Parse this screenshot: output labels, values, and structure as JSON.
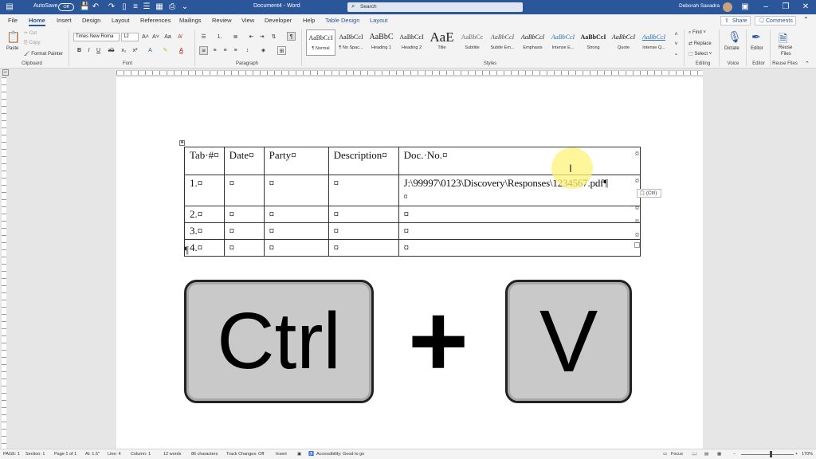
{
  "titlebar": {
    "autosave_label": "AutoSave",
    "autosave_state": "Off",
    "doc_title": "Document4 - Word",
    "search_placeholder": "Search",
    "user_name": "Deborah Savadra"
  },
  "tabs": [
    "File",
    "Home",
    "Insert",
    "Design",
    "Layout",
    "References",
    "Mailings",
    "Review",
    "View",
    "Developer",
    "Help",
    "Table Design",
    "Layout"
  ],
  "share_label": "Share",
  "comments_label": "Comments",
  "clipboard": {
    "paste": "Paste",
    "cut": "Cut",
    "copy": "Copy",
    "format_painter": "Format Painter",
    "group": "Clipboard"
  },
  "font": {
    "name": "Times New Roma",
    "size": "12",
    "group": "Font"
  },
  "paragraph_group": "Paragraph",
  "styles": [
    {
      "preview": "AaBbCcI",
      "name": "¶ Normal"
    },
    {
      "preview": "AaBbCcI",
      "name": "¶ No Spac..."
    },
    {
      "preview": "AaBbC",
      "name": "Heading 1"
    },
    {
      "preview": "AaBbCcI",
      "name": "Heading 2"
    },
    {
      "preview": "AaE",
      "name": "Title"
    },
    {
      "preview": "AaBbCc",
      "name": "Subtitle"
    },
    {
      "preview": "AaBbCcI",
      "name": "Subtle Em..."
    },
    {
      "preview": "AaBbCcI",
      "name": "Emphasis"
    },
    {
      "preview": "AaBbCcI",
      "name": "Intense E..."
    },
    {
      "preview": "AaBbCcI",
      "name": "Strong"
    },
    {
      "preview": "AaBbCcI",
      "name": "Quote"
    },
    {
      "preview": "AaBbCcI",
      "name": "Intense Q..."
    }
  ],
  "styles_group": "Styles",
  "editing": {
    "find": "Find",
    "replace": "Replace",
    "select": "Select",
    "group": "Editing"
  },
  "voice": {
    "dictate": "Dictate",
    "group": "Voice"
  },
  "editor": {
    "label": "Editor",
    "group": "Editor"
  },
  "reuse": {
    "label1": "Reuse",
    "label2": "Files",
    "group": "Reuse Files"
  },
  "table": {
    "headers": [
      "Tab·#¤",
      "Date¤",
      "Party¤",
      "Description¤",
      "Doc.·No.¤"
    ],
    "rows": [
      [
        "1.¤",
        "¤",
        "¤",
        "¤",
        "J:\\99997\\0123\\Discovery\\Responses\\1234567.pdf¶"
      ],
      [
        "2.¤",
        "¤",
        "¤",
        "¤",
        "¤"
      ],
      [
        "3.¤",
        "¤",
        "¤",
        "¤",
        "¤"
      ],
      [
        "4.¤",
        "¤",
        "¤",
        "¤",
        "¤"
      ]
    ],
    "row_end_mark": "¤",
    "pilcrow": "¶",
    "extra_mark": "¤"
  },
  "paste_options": "(Ctrl)",
  "keys": {
    "ctrl": "Ctrl",
    "plus": "+",
    "v": "V"
  },
  "status": {
    "page": "PAGE: 1",
    "section": "Section: 1",
    "pageof": "Page 1 of 1",
    "at": "At: 1.5\"",
    "line": "Line: 4",
    "column": "Column: 1",
    "words": "12 words",
    "chars": "86 characters",
    "track": "Track Changes: Off",
    "insert": "Insert",
    "accessibility": "Accessibility: Good to go",
    "focus": "Focus",
    "zoom": "170%"
  },
  "colors": {
    "accent": "#2b579a",
    "highlight": "#fff27a"
  }
}
